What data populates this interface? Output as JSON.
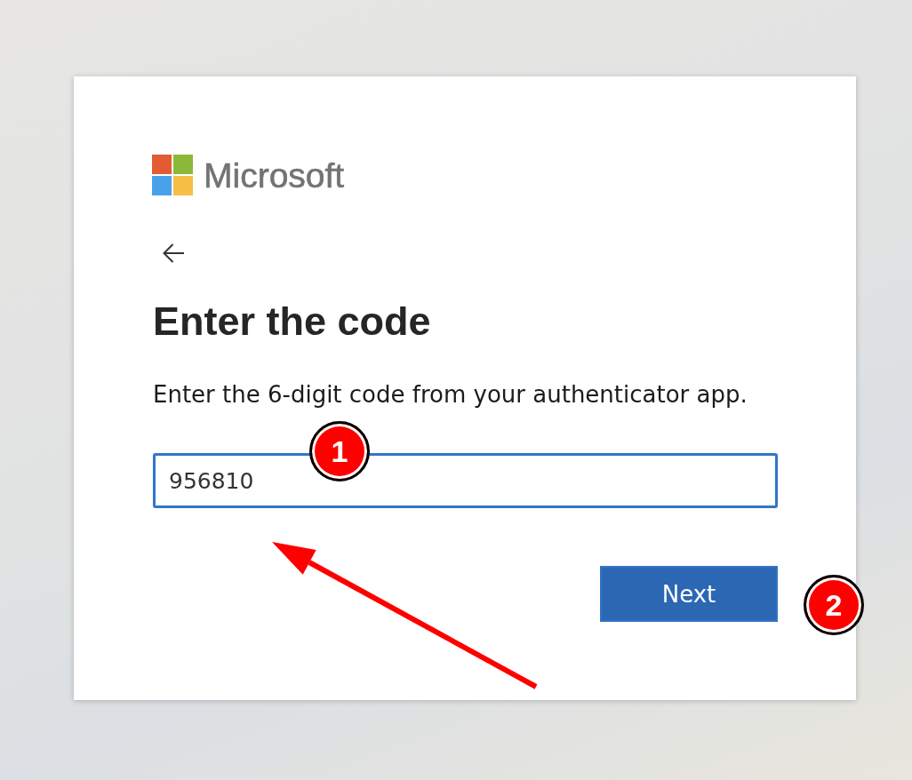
{
  "logo": {
    "text": "Microsoft"
  },
  "title": "Enter the code",
  "instructions": "Enter the 6-digit code from your authenticator app.",
  "code_field": {
    "value": "956810",
    "focused": true,
    "marker": "1"
  },
  "next_button": {
    "label": "Next",
    "marker": "2"
  }
}
